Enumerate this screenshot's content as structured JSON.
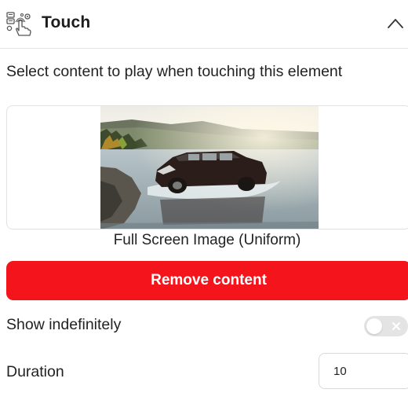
{
  "header": {
    "title": "Touch",
    "icon": "touch-gesture-icon",
    "collapse_icon": "chevron-up-icon"
  },
  "description": "Select content to play when touching this element",
  "content": {
    "name": "Full Screen Image (Uniform)",
    "thumbnail": "suv-driving-through-water-photo"
  },
  "remove_button": {
    "label": "Remove content",
    "color": "#f4141b"
  },
  "show_indefinitely": {
    "label": "Show indefinitely",
    "enabled": false
  },
  "duration": {
    "label": "Duration",
    "value": "10"
  }
}
